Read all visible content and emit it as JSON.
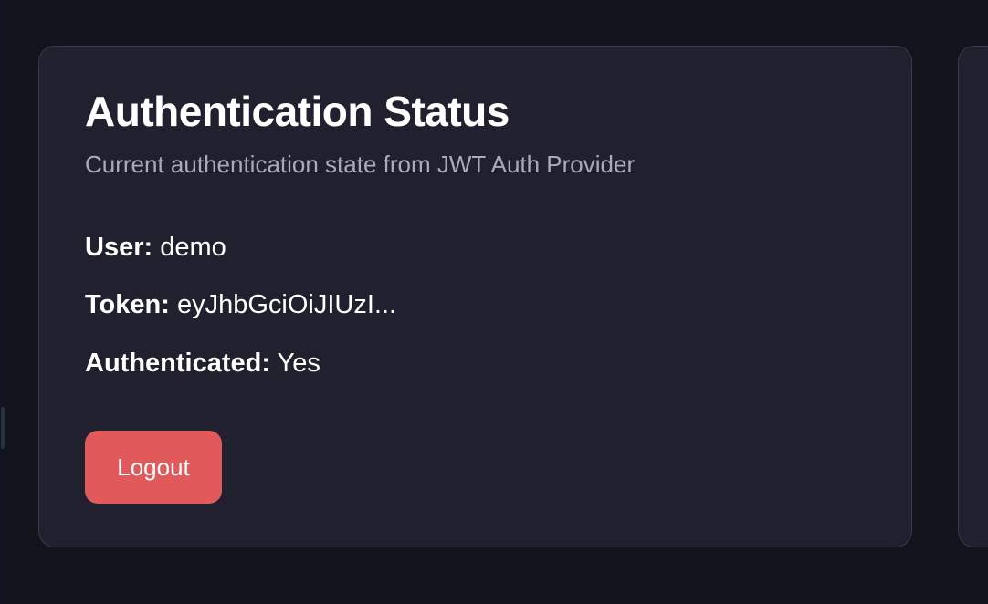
{
  "card": {
    "title": "Authentication Status",
    "subtitle": "Current authentication state from JWT Auth Provider",
    "fields": {
      "user": {
        "label": "User:",
        "value": "demo"
      },
      "token": {
        "label": "Token:",
        "value": "eyJhbGciOiJIUzI..."
      },
      "authenticated": {
        "label": "Authenticated:",
        "value": "Yes"
      }
    },
    "logout_label": "Logout"
  },
  "colors": {
    "background": "#13131b",
    "card": "#20202e",
    "card_border": "#393a4d",
    "logout_button": "#e05a5c"
  }
}
